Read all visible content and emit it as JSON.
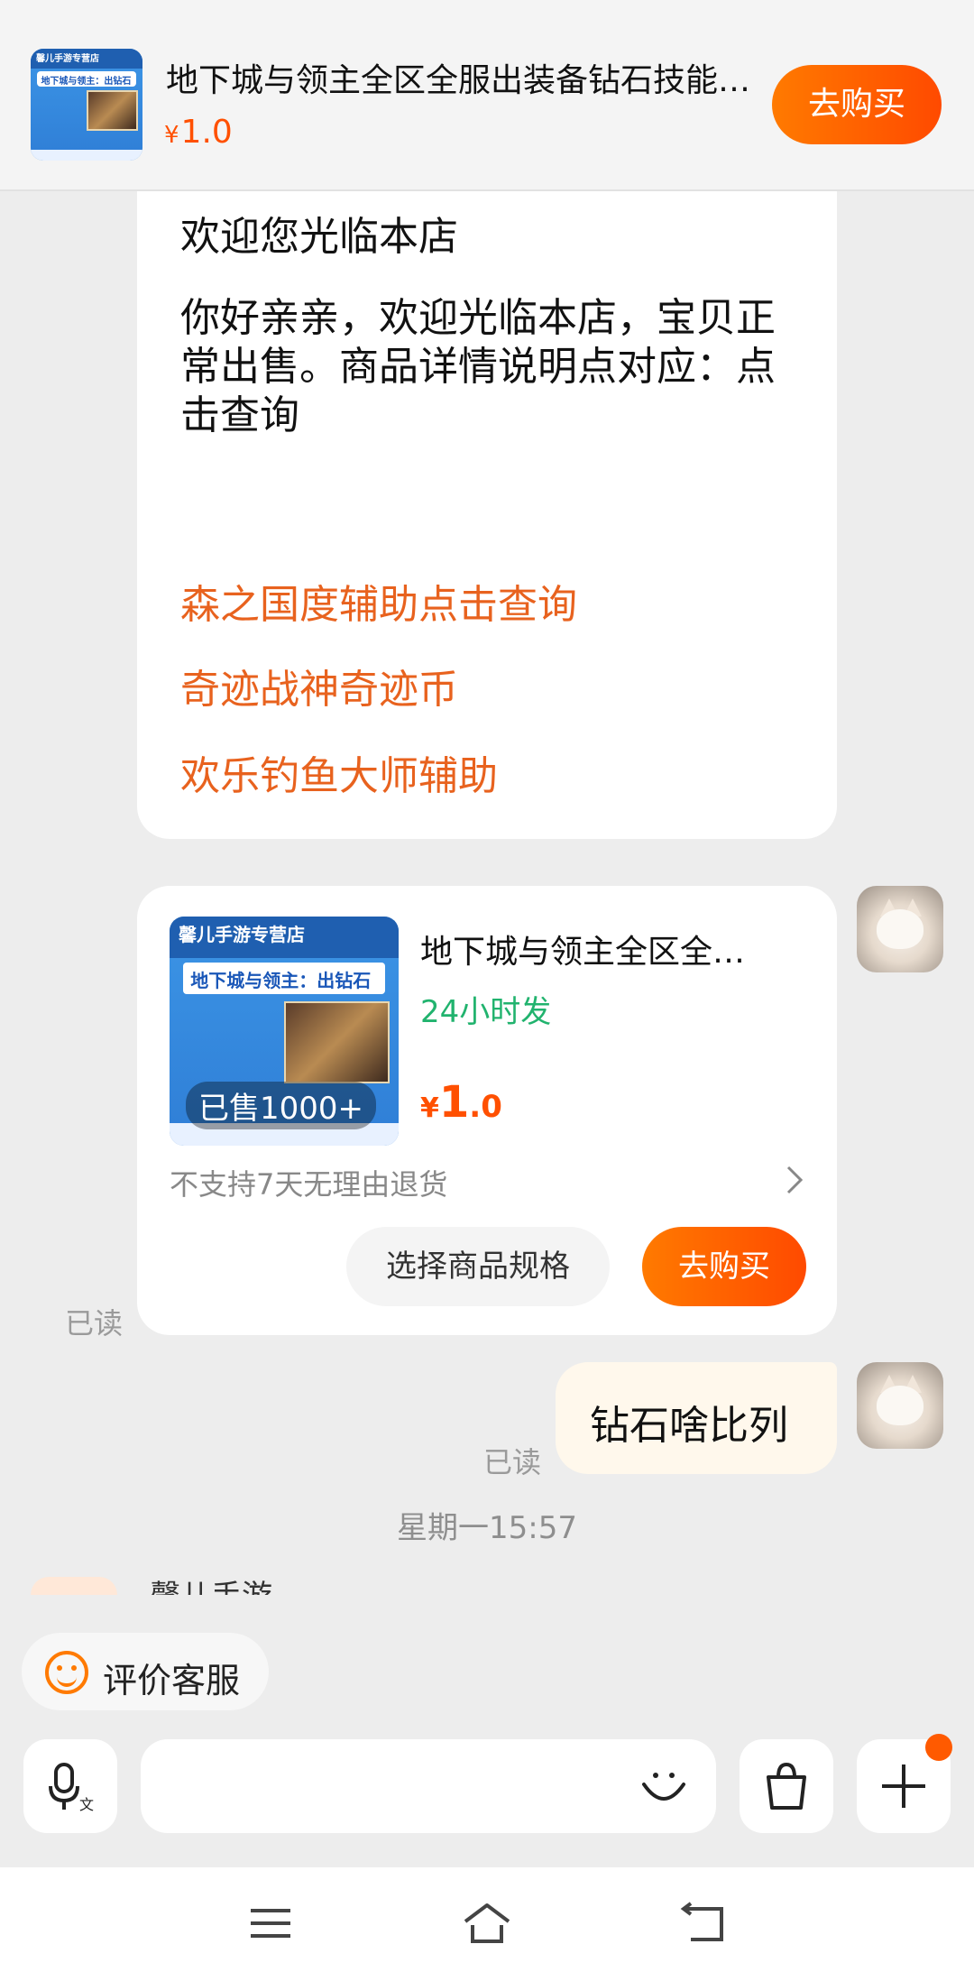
{
  "header": {
    "product_title": "地下城与领主全区全服出装备钻石技能…",
    "price_currency": "¥",
    "price_value": "1.0",
    "buy_label": "去购买",
    "thumb_banner": "地下城与领主：出钻石",
    "thumb_store": "馨儿手游专营店"
  },
  "welcome": {
    "heading": "欢迎您光临本店",
    "body": "你好亲亲，欢迎光临本店，宝贝正常出售。商品详情说明点对应：点击查询",
    "links": [
      "森之国度辅助点击查询",
      "奇迹战神奇迹币",
      "欢乐钓鱼大师辅助"
    ]
  },
  "product_card": {
    "title": "地下城与领主全区全…",
    "shipping": "24小时发",
    "sold": "已售1000+",
    "price_currency": "¥",
    "price_int": "1",
    "price_dec": ".0",
    "policy": "不支持7天无理由退货",
    "spec_label": "选择商品规格",
    "buy_label": "去购买"
  },
  "messages": {
    "read_label": "已读",
    "mine_text": "钻石啥比列",
    "timestamp": "星期一15:57",
    "next_sender": "馨儿手游"
  },
  "bottom": {
    "rate_label": "评价客服",
    "input_placeholder": ""
  },
  "colors": {
    "accent": "#ff5000",
    "link": "#e8621e",
    "shipping": "#21b36e"
  },
  "icons": [
    "voice-input-icon",
    "emoji-icon",
    "shopping-bag-icon",
    "plus-icon",
    "menu-icon",
    "home-icon",
    "back-icon",
    "chevron-right-icon",
    "smile-icon"
  ]
}
